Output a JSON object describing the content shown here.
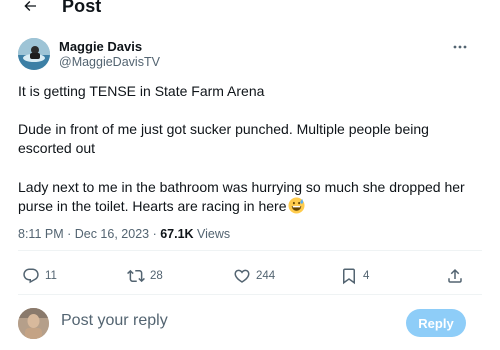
{
  "header": {
    "title": "Post"
  },
  "tweet": {
    "author_name": "Maggie Davis",
    "author_handle": "@MaggieDavisTV",
    "paragraphs": [
      "It is getting TENSE in State Farm Arena",
      "Dude in front of me just got sucker punched. Multiple people being escorted out",
      "Lady next to me in the bathroom was hurrying so much she dropped her purse in the toilet. Hearts are racing in here"
    ],
    "emoji_icon": "grinning-sweat-emoji",
    "timestamp": "8:11 PM · Dec 16, 2023 · ",
    "views_count": "67.1K",
    "views_label": " Views"
  },
  "actions": {
    "replies": "11",
    "reposts": "28",
    "likes": "244",
    "bookmarks": "4"
  },
  "reply_box": {
    "placeholder": "Post your reply",
    "button_label": "Reply",
    "button_color": "#8ecdf8"
  }
}
